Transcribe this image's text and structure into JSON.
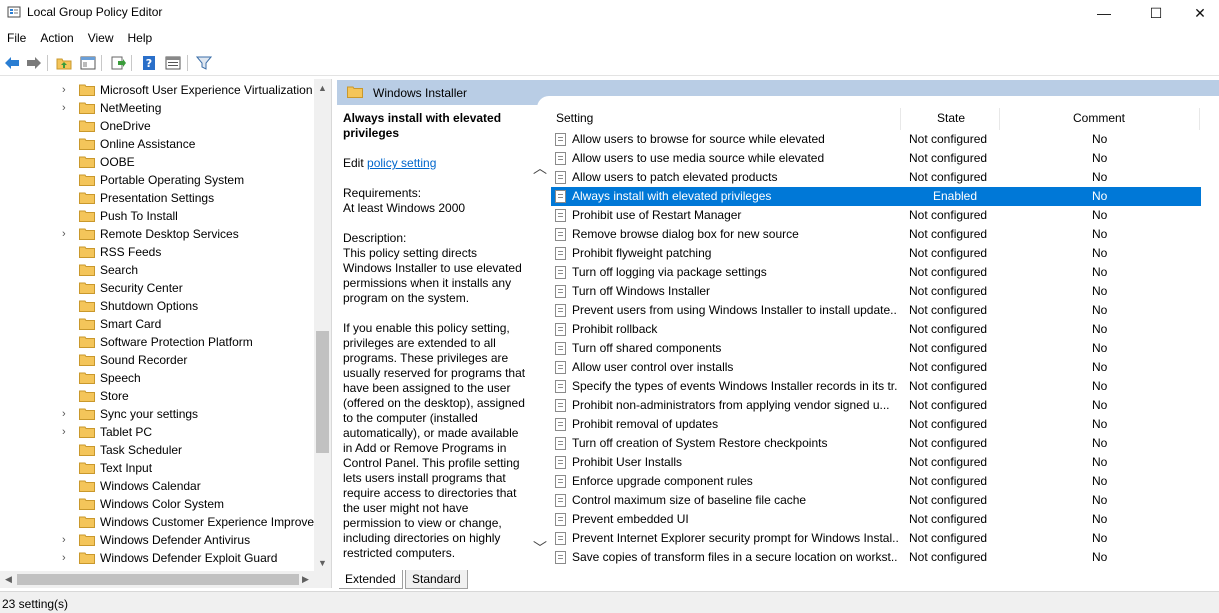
{
  "window": {
    "title": "Local Group Policy Editor",
    "minimize": "—",
    "maximize": "☐",
    "close": "✕"
  },
  "menu": [
    "File",
    "Action",
    "View",
    "Help"
  ],
  "tree": [
    {
      "label": "Microsoft User Experience Virtualization",
      "expand": true
    },
    {
      "label": "NetMeeting",
      "expand": true
    },
    {
      "label": "OneDrive",
      "expand": false
    },
    {
      "label": "Online Assistance",
      "expand": false
    },
    {
      "label": "OOBE",
      "expand": false
    },
    {
      "label": "Portable Operating System",
      "expand": false
    },
    {
      "label": "Presentation Settings",
      "expand": false
    },
    {
      "label": "Push To Install",
      "expand": false
    },
    {
      "label": "Remote Desktop Services",
      "expand": true
    },
    {
      "label": "RSS Feeds",
      "expand": false
    },
    {
      "label": "Search",
      "expand": false
    },
    {
      "label": "Security Center",
      "expand": false
    },
    {
      "label": "Shutdown Options",
      "expand": false
    },
    {
      "label": "Smart Card",
      "expand": false
    },
    {
      "label": "Software Protection Platform",
      "expand": false
    },
    {
      "label": "Sound Recorder",
      "expand": false
    },
    {
      "label": "Speech",
      "expand": false
    },
    {
      "label": "Store",
      "expand": false
    },
    {
      "label": "Sync your settings",
      "expand": true
    },
    {
      "label": "Tablet PC",
      "expand": true
    },
    {
      "label": "Task Scheduler",
      "expand": false
    },
    {
      "label": "Text Input",
      "expand": false
    },
    {
      "label": "Windows Calendar",
      "expand": false
    },
    {
      "label": "Windows Color System",
      "expand": false
    },
    {
      "label": "Windows Customer Experience Improver",
      "expand": false
    },
    {
      "label": "Windows Defender Antivirus",
      "expand": true
    },
    {
      "label": "Windows Defender Exploit Guard",
      "expand": true
    }
  ],
  "pane": {
    "title": "Windows Installer",
    "desc_title": "Always install with elevated privileges",
    "edit_prefix": "Edit ",
    "edit_link": "policy setting ",
    "requirements_label": "Requirements:",
    "requirements_value": "At least Windows 2000",
    "description_label": "Description:",
    "description_p1": "This policy setting directs Windows Installer to use elevated permissions when it installs any program on the system.",
    "description_p2": "If you enable this policy setting, privileges are extended to all programs. These privileges are usually reserved for programs that have been assigned to the user (offered on the desktop), assigned to the computer (installed automatically), or made available in Add or Remove Programs in Control Panel. This profile setting lets users install programs that require access to directories that the user might not have permission to view or change, including directories on highly restricted computers."
  },
  "columns": {
    "setting": "Setting",
    "state": "State",
    "comment": "Comment"
  },
  "rows": [
    {
      "setting": "Allow users to browse for source while elevated",
      "state": "Not configured",
      "comment": "No"
    },
    {
      "setting": "Allow users to use media source while elevated",
      "state": "Not configured",
      "comment": "No"
    },
    {
      "setting": "Allow users to patch elevated products",
      "state": "Not configured",
      "comment": "No"
    },
    {
      "setting": "Always install with elevated privileges",
      "state": "Enabled",
      "comment": "No",
      "selected": true
    },
    {
      "setting": "Prohibit use of Restart Manager",
      "state": "Not configured",
      "comment": "No"
    },
    {
      "setting": "Remove browse dialog box for new source",
      "state": "Not configured",
      "comment": "No"
    },
    {
      "setting": "Prohibit flyweight patching",
      "state": "Not configured",
      "comment": "No"
    },
    {
      "setting": "Turn off logging via package settings",
      "state": "Not configured",
      "comment": "No"
    },
    {
      "setting": "Turn off Windows Installer",
      "state": "Not configured",
      "comment": "No"
    },
    {
      "setting": "Prevent users from using Windows Installer to install update...",
      "state": "Not configured",
      "comment": "No"
    },
    {
      "setting": "Prohibit rollback",
      "state": "Not configured",
      "comment": "No"
    },
    {
      "setting": "Turn off shared components",
      "state": "Not configured",
      "comment": "No"
    },
    {
      "setting": "Allow user control over installs",
      "state": "Not configured",
      "comment": "No"
    },
    {
      "setting": "Specify the types of events Windows Installer records in its tr...",
      "state": "Not configured",
      "comment": "No"
    },
    {
      "setting": "Prohibit non-administrators from applying vendor signed u...",
      "state": "Not configured",
      "comment": "No"
    },
    {
      "setting": "Prohibit removal of updates",
      "state": "Not configured",
      "comment": "No"
    },
    {
      "setting": "Turn off creation of System Restore checkpoints",
      "state": "Not configured",
      "comment": "No"
    },
    {
      "setting": "Prohibit User Installs",
      "state": "Not configured",
      "comment": "No"
    },
    {
      "setting": "Enforce upgrade component rules",
      "state": "Not configured",
      "comment": "No"
    },
    {
      "setting": "Control maximum size of baseline file cache",
      "state": "Not configured",
      "comment": "No"
    },
    {
      "setting": "Prevent embedded UI",
      "state": "Not configured",
      "comment": "No"
    },
    {
      "setting": "Prevent Internet Explorer security prompt for Windows Instal...",
      "state": "Not configured",
      "comment": "No"
    },
    {
      "setting": "Save copies of transform files in a secure location on workst...",
      "state": "Not configured",
      "comment": "No"
    }
  ],
  "tabs": [
    "Extended",
    "Standard"
  ],
  "status": "23 setting(s)",
  "colors": {
    "selection": "#0078d7",
    "header": "#b9cde5",
    "link": "#0066cc",
    "folder": "#f4c55a"
  }
}
